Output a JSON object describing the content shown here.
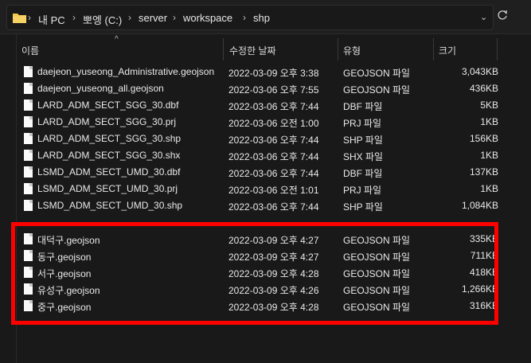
{
  "address": {
    "crumbs": [
      "내 PC",
      "뽀엥 (C:)",
      "server",
      "workspace",
      "shp"
    ],
    "separator": "›"
  },
  "columns": {
    "name": "이름",
    "date": "수정한 날짜",
    "type": "유형",
    "size": "크기"
  },
  "files": [
    {
      "name": "daejeon_yuseong_Administrative.geojson",
      "date": "2022-03-09 오후 3:38",
      "type": "GEOJSON 파일",
      "size": "3,043KB"
    },
    {
      "name": "daejeon_yuseong_all.geojson",
      "date": "2022-03-06 오후 7:55",
      "type": "GEOJSON 파일",
      "size": "436KB"
    },
    {
      "name": "LARD_ADM_SECT_SGG_30.dbf",
      "date": "2022-03-06 오후 7:44",
      "type": "DBF 파일",
      "size": "5KB"
    },
    {
      "name": "LARD_ADM_SECT_SGG_30.prj",
      "date": "2022-03-06 오전 1:00",
      "type": "PRJ 파일",
      "size": "1KB"
    },
    {
      "name": "LARD_ADM_SECT_SGG_30.shp",
      "date": "2022-03-06 오후 7:44",
      "type": "SHP 파일",
      "size": "156KB"
    },
    {
      "name": "LARD_ADM_SECT_SGG_30.shx",
      "date": "2022-03-06 오후 7:44",
      "type": "SHX 파일",
      "size": "1KB"
    },
    {
      "name": "LSMD_ADM_SECT_UMD_30.dbf",
      "date": "2022-03-06 오후 7:44",
      "type": "DBF 파일",
      "size": "137KB"
    },
    {
      "name": "LSMD_ADM_SECT_UMD_30.prj",
      "date": "2022-03-06 오전 1:01",
      "type": "PRJ 파일",
      "size": "1KB"
    },
    {
      "name": "LSMD_ADM_SECT_UMD_30.shp",
      "date": "2022-03-06 오후 7:44",
      "type": "SHP 파일",
      "size": "1,084KB"
    },
    {
      "name": "대덕구.geojson",
      "date": "2022-03-09 오후 4:27",
      "type": "GEOJSON 파일",
      "size": "335KB"
    },
    {
      "name": "동구.geojson",
      "date": "2022-03-09 오후 4:27",
      "type": "GEOJSON 파일",
      "size": "711KB"
    },
    {
      "name": "서구.geojson",
      "date": "2022-03-09 오후 4:28",
      "type": "GEOJSON 파일",
      "size": "418KB"
    },
    {
      "name": "유성구.geojson",
      "date": "2022-03-09 오후 4:26",
      "type": "GEOJSON 파일",
      "size": "1,266KB"
    },
    {
      "name": "중구.geojson",
      "date": "2022-03-09 오후 4:28",
      "type": "GEOJSON 파일",
      "size": "316KB"
    }
  ],
  "colors": {
    "highlight": "#ff0000",
    "folder": "#f2c94c"
  }
}
